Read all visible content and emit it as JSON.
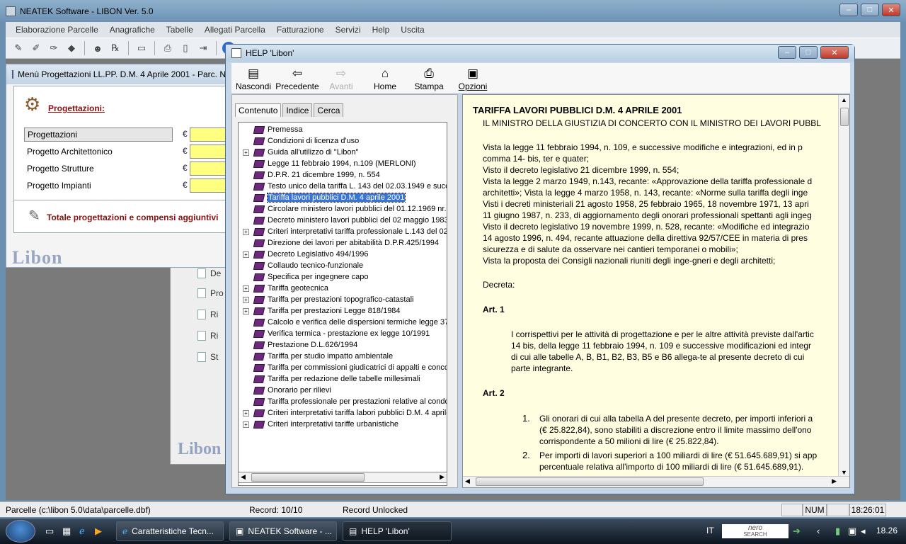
{
  "app": {
    "title": "NEATEK Software  -  LIBON Ver. 5.0"
  },
  "menu": [
    "Elaborazione Parcelle",
    "Anagrafiche",
    "Tabelle",
    "Allegati Parcella",
    "Fatturazione",
    "Servizi",
    "Help",
    "Uscita"
  ],
  "prog": {
    "title": "Menù Progettazioni LL.PP. D.M. 4 Aprile 2001 - Parc. N",
    "heading": "Progettazioni:",
    "rows": [
      "Progettazioni",
      "Progetto Architettonico",
      "Progetto Strutture",
      "Progetto Impianti"
    ],
    "currency": "€",
    "total": "Totale progettazioni e compensi aggiuntivi",
    "logo": "Libon"
  },
  "bg": {
    "items": [
      "De",
      "Pro",
      "Ri",
      "Ri",
      "St"
    ],
    "logo": "Libon"
  },
  "help": {
    "title": "HELP 'Libon'",
    "toolbar": {
      "hide": "Nascondi",
      "back": "Precedente",
      "forward": "Avanti",
      "home": "Home",
      "print": "Stampa",
      "options": "Opzioni"
    },
    "tabs": {
      "contents": "Contenuto",
      "index": "Indice",
      "search": "Cerca"
    },
    "tree": [
      {
        "label": "Premessa",
        "exp": false
      },
      {
        "label": "Condizioni di licenza d'uso",
        "exp": false
      },
      {
        "label": "Guida all'utilizzo di \"Libon\"",
        "exp": true
      },
      {
        "label": "Legge 11 febbraio 1994, n.109 (MERLONI)",
        "exp": false
      },
      {
        "label": "D.P.R. 21 dicembre 1999, n. 554",
        "exp": false
      },
      {
        "label": "Testo unico della tariffa L. 143 del 02.03.1949 e succ",
        "exp": false
      },
      {
        "label": "Tariffa lavori pubblici D.M. 4 aprile 2001",
        "exp": false,
        "selected": true
      },
      {
        "label": "Circolare ministero lavori pubblici del 01.12.1969 nr.66",
        "exp": false
      },
      {
        "label": "Decreto ministero lavori pubblici del 02 maggio 1983 (",
        "exp": false
      },
      {
        "label": "Criteri interpretativi tariffa professionale L.143 del 02.0",
        "exp": true
      },
      {
        "label": "Direzione dei lavori per abitabilità D.P.R.425/1994",
        "exp": false
      },
      {
        "label": "Decreto Legislativo 494/1996",
        "exp": true
      },
      {
        "label": "Collaudo tecnico-funzionale",
        "exp": false
      },
      {
        "label": "Specifica per ingegnere capo",
        "exp": false
      },
      {
        "label": "Tariffa geotecnica",
        "exp": true
      },
      {
        "label": "Tariffa per prestazioni topografico-catastali",
        "exp": true
      },
      {
        "label": "Tariffa per prestazioni Legge 818/1984",
        "exp": true
      },
      {
        "label": "Calcolo e verifica delle dispersioni termiche legge 373",
        "exp": false
      },
      {
        "label": "Verifica termica - prestazione ex legge 10/1991",
        "exp": false
      },
      {
        "label": "Prestazione D.L.626/1994",
        "exp": false
      },
      {
        "label": "Tariffa per studio impatto ambientale",
        "exp": false
      },
      {
        "label": "Tariffa per commissioni giudicatrici di appalti e concor",
        "exp": false
      },
      {
        "label": "Tariffa per redazione delle tabelle millesimali",
        "exp": false
      },
      {
        "label": "Onorario per rilievi",
        "exp": false
      },
      {
        "label": "Tariffa professionale per prestazioni relative al condor",
        "exp": false
      },
      {
        "label": "Criteri interpretativi tariffa labori pubblici D.M. 4 aprile 2",
        "exp": true
      },
      {
        "label": "Criteri interpretativi tariffe urbanistiche",
        "exp": true
      }
    ],
    "doc": {
      "heading": "TARIFFA LAVORI PUBBLICI D.M. 4 APRILE 2001",
      "intro": "IL MINISTRO DELLA GIUSTIZIA DI CONCERTO CON IL MINISTRO DEI LAVORI PUBBL",
      "visti": [
        "Vista la legge 11 febbraio 1994, n. 109, e successive modifiche e integrazioni, ed in p",
        "comma 14- bis, ter e quater;",
        "Visto il decreto legislativo 21 dicembre 1999, n. 554;",
        "Vista la legge 2 marzo 1949, n.143, recante: «Approvazione della tariffa professionale d",
        "architetti»; Vista la legge 4 marzo 1958, n. 143, recante: «Norme sulla tariffa degli inge",
        "Visti i decreti ministeriali 21 agosto 1958, 25 febbraio 1965, 18 novembre 1971, 13 apri",
        "11 giugno 1987, n. 233, di aggiornamento degli onorari professionali spettanti agli ingeg",
        "Visto il decreto legislativo 19 novembre 1999, n. 528, recante: «Modifiche ed integrazio",
        "14 agosto 1996, n. 494, recante attuazione della direttiva 92/57/CEE in materia di pres",
        "sicurezza e di salute da osservare nei cantieri temporanei o mobili»;",
        "Vista la proposta dei Consigli nazionali riuniti degli inge-gneri e degli architetti;"
      ],
      "decreta": "Decreta:",
      "art1": "Art. 1",
      "art1_text": [
        "I corrispettivi per le attività di progettazione e per le altre attività previste dall'artic",
        "14 bis, della legge 11 febbraio 1994, n. 109 e successive modificazioni ed integr",
        "di cui alle tabelle A, B, B1, B2, B3, B5 e B6 allega-te al presente decreto di cui",
        "parte integrante."
      ],
      "art2": "Art. 2",
      "art2_items": [
        {
          "num": "1.",
          "lines": [
            "Gli onorari di cui alla tabella A del presente decreto, per importi inferiori a",
            "(€ 25.822,84), sono stabiliti a discrezione entro il limite massimo dell'ono",
            "corrispondente a 50 milioni di lire (€ 25.822,84)."
          ]
        },
        {
          "num": "2.",
          "lines": [
            "Per importi di lavori superiori a 100 miliardi di lire (€ 51.645.689,91) si app",
            "percentuale relativa all'importo di 100 miliardi di lire (€ 51.645.689,91)."
          ]
        }
      ]
    }
  },
  "status": {
    "file": "Parcelle (c:\\libon 5.0\\data\\parcelle.dbf)",
    "record": "Record: 10/10",
    "lock": "Record Unlocked",
    "num": "NUM",
    "time": "18:26:01"
  },
  "taskbar": {
    "tasks": [
      "Caratteristiche Tecn...",
      "NEATEK Software  - ...",
      "HELP 'Libon'"
    ],
    "lang": "IT",
    "search": "nero",
    "search_sub": "SEARCH",
    "clock": "18.26"
  }
}
